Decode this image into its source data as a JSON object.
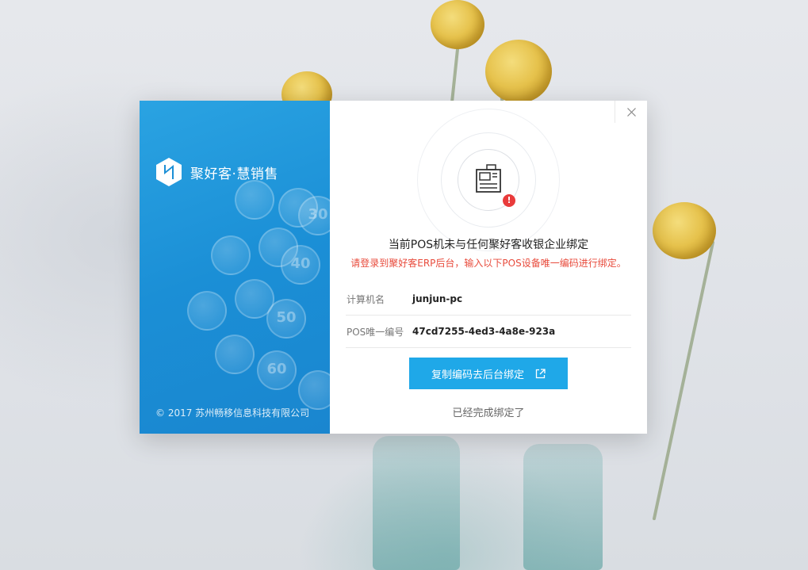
{
  "window": {
    "title": "聚好客·慧销售"
  },
  "sidebar": {
    "brand": "聚好客·慧销售",
    "copyright": "© 2017 苏州畅移信息科技有限公司",
    "key_numbers": [
      "30",
      "40",
      "50",
      "60"
    ]
  },
  "dialog": {
    "title": "当前POS机未与任何聚好客收银企业绑定",
    "subtitle": "请登录到聚好客ERP后台，输入以下POS设备唯一编码进行绑定。",
    "computer_name_label": "计算机名",
    "computer_name_value": "junjun-pc",
    "pos_id_label": "POS唯一编号",
    "pos_id_value": "47cd7255-4ed3-4a8e-923a",
    "copy_button_label": "复制编码去后台绑定",
    "done_link_label": "已经完成绑定了",
    "warn_mark": "!"
  },
  "colors": {
    "accent": "#1fa8e8",
    "sidebar_bg": "#1b8fd6",
    "warning": "#e84b3c"
  },
  "icons": [
    "close-icon",
    "pos-terminal-icon",
    "warning-badge-icon",
    "external-link-icon",
    "brand-logo-icon"
  ]
}
